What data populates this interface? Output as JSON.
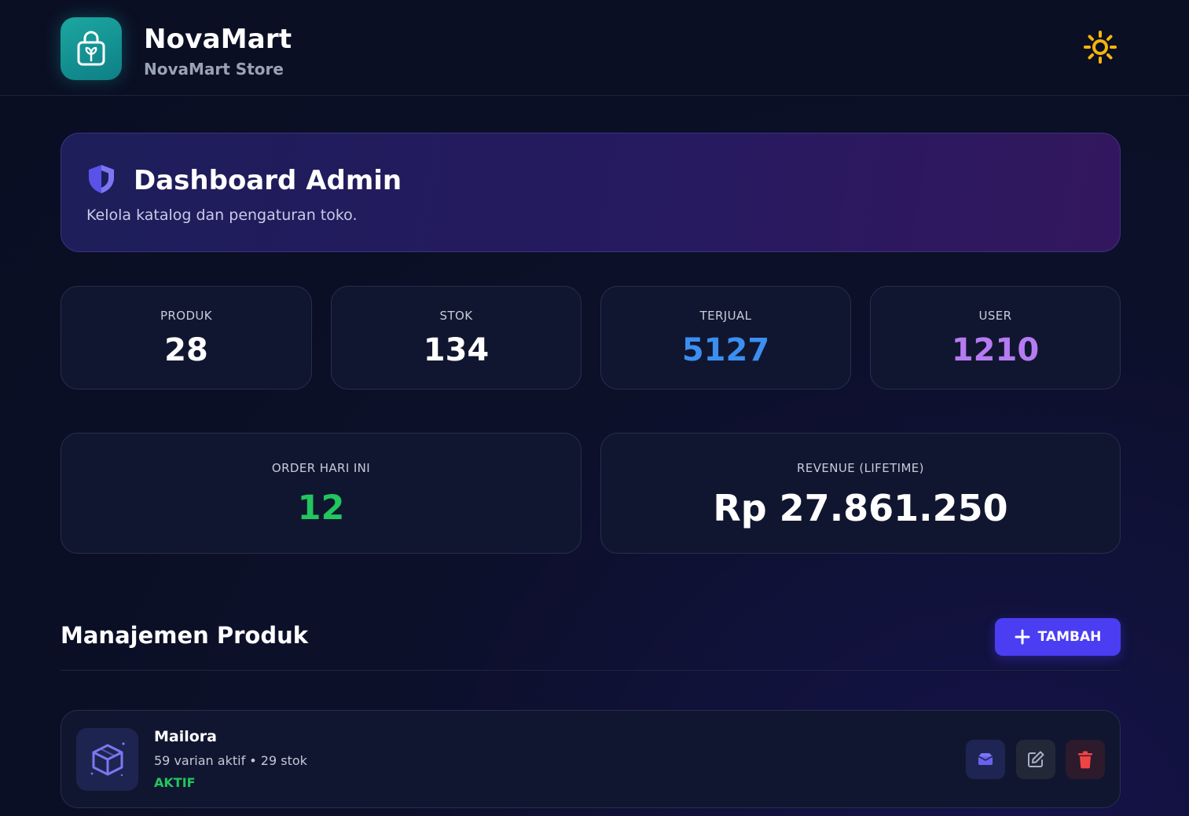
{
  "header": {
    "brand_name": "NovaMart",
    "brand_sub": "NovaMart Store"
  },
  "hero": {
    "title": "Dashboard Admin",
    "subtitle": "Kelola katalog dan pengaturan toko."
  },
  "stats": [
    {
      "label": "PRODUK",
      "value": "28",
      "color": "#ffffff"
    },
    {
      "label": "STOK",
      "value": "134",
      "color": "#ffffff"
    },
    {
      "label": "TERJUAL",
      "value": "5127",
      "color": "#3b8ff0"
    },
    {
      "label": "USER",
      "value": "1210",
      "color": "#b57cf2"
    }
  ],
  "wide_stats": [
    {
      "label": "ORDER HARI INI",
      "value": "12",
      "color": "#22c55e"
    },
    {
      "label": "REVENUE (LIFETIME)",
      "value": "Rp 27.861.250",
      "color": "#ffffff"
    }
  ],
  "section": {
    "title": "Manajemen Produk",
    "add_label": "TAMBAH"
  },
  "products": [
    {
      "name": "Mailora",
      "meta": "59 varian aktif • 29 stok",
      "status": "AKTIF"
    }
  ],
  "colors": {
    "accent": "#4a3df2",
    "success": "#22c55e",
    "danger": "#ef4444",
    "sun": "#f5b50a"
  },
  "icons": {
    "logo": "shopping-bag-icon",
    "theme": "sun-icon",
    "hero": "shield-icon",
    "product": "cube-icon",
    "variants": "box-icon",
    "edit": "edit-icon",
    "delete": "trash-icon"
  }
}
